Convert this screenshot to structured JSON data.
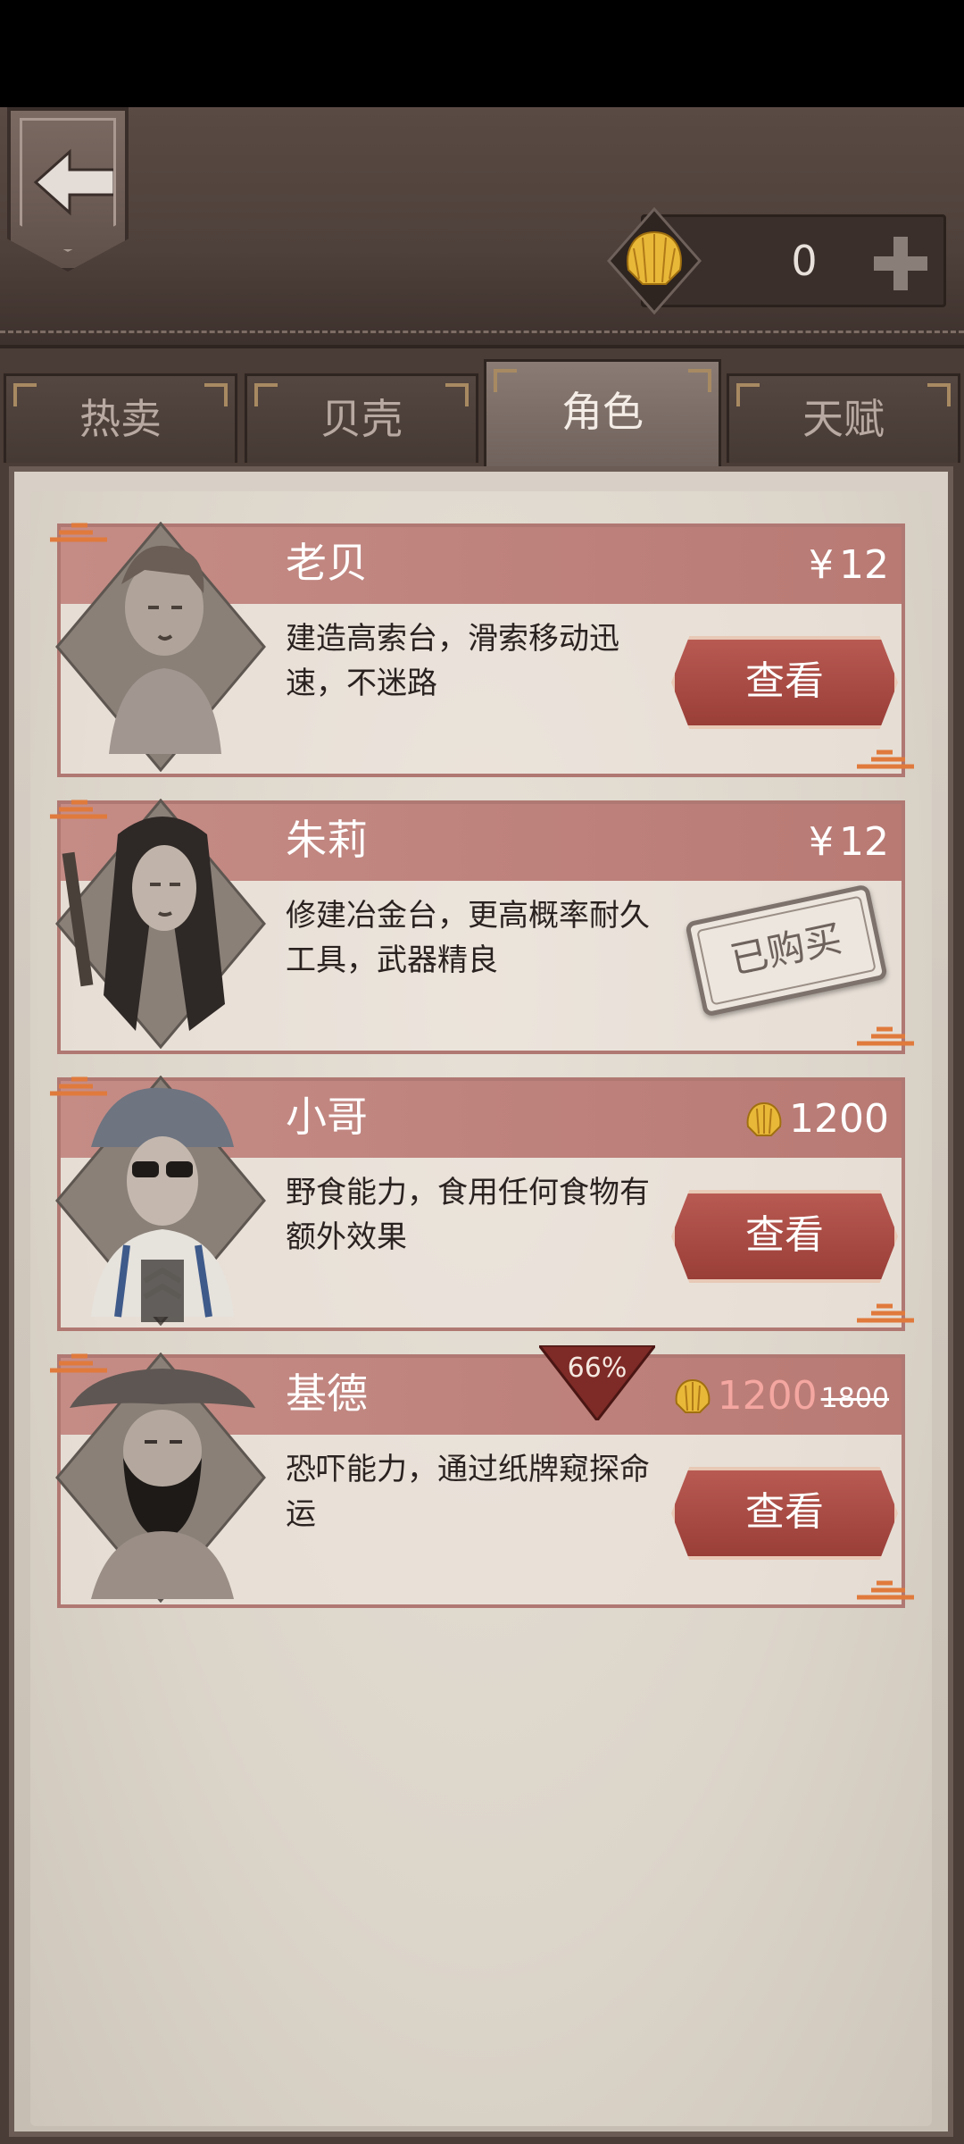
{
  "currency": {
    "value": "0"
  },
  "tabs": [
    {
      "label": "热卖",
      "active": false
    },
    {
      "label": "贝壳",
      "active": false
    },
    {
      "label": "角色",
      "active": true
    },
    {
      "label": "天赋",
      "active": false
    }
  ],
  "characters": [
    {
      "name": "老贝",
      "price_symbol": "¥",
      "price": "12",
      "desc": "建造高索台，滑索移动迅速，不迷路",
      "action": "查看"
    },
    {
      "name": "朱莉",
      "price_symbol": "¥",
      "price": "12",
      "desc": "修建冶金台，更高概率耐久工具，武器精良",
      "stamp": "已购买"
    },
    {
      "name": "小哥",
      "price": "1200",
      "desc": "野食能力，食用任何食物有额外效果",
      "action": "查看"
    },
    {
      "name": "基德",
      "discount": "66%",
      "price": "1200",
      "old_price": "1800",
      "desc": "恐吓能力，通过纸牌窥探命运",
      "action": "查看"
    }
  ],
  "colors": {
    "banner": "#b97a74",
    "button": "#9a3e38",
    "shell": "#e0b030",
    "sale_price": "#f4a6a0"
  },
  "icons": {
    "back": "back-arrow-icon",
    "currency": "shell-icon",
    "add": "plus-icon"
  }
}
